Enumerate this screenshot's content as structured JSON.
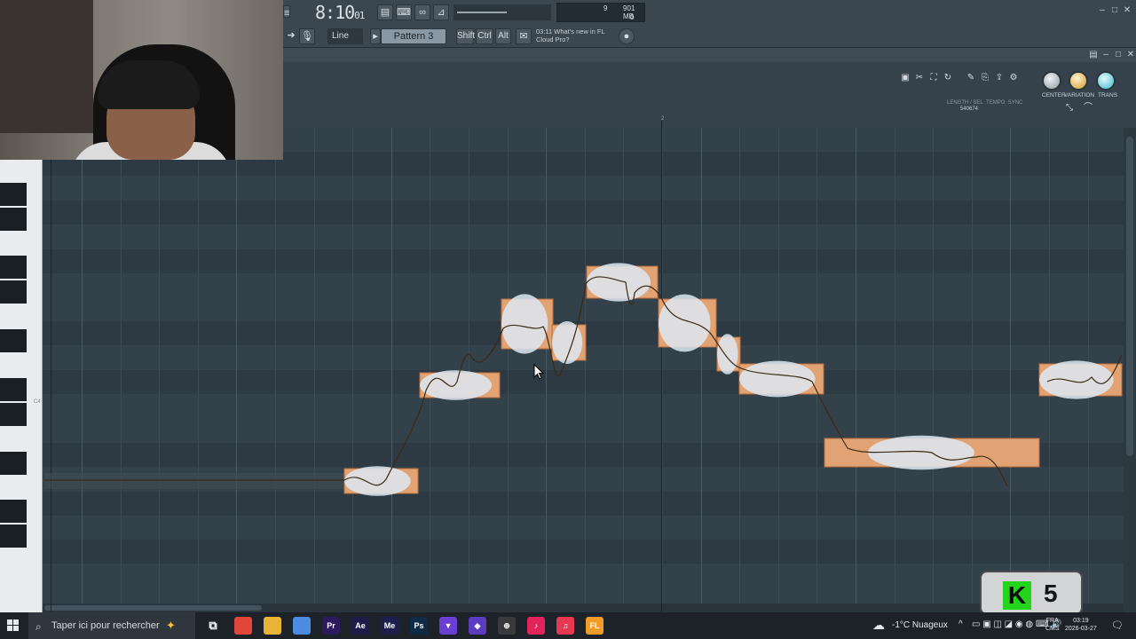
{
  "toolbar": {
    "time_main": "8:10",
    "time_sub": "01",
    "snap_label": "Line",
    "pattern_label": "Pattern 3",
    "shift_label": "Shift",
    "ctrl_label": "Ctrl",
    "alt_label": "Alt",
    "news_line1": "03:11  What's new in FL",
    "news_line2": "Cloud Pro?",
    "cpu_value": "9",
    "memory_value": "901 MB",
    "poly_value": "0"
  },
  "plugin": {
    "knobs": [
      {
        "label": "CENTER"
      },
      {
        "label": "VARIATION"
      },
      {
        "label": "TRANS"
      }
    ],
    "length_label": "LENGTH / SEL",
    "tempo_label": "TEMPO",
    "sync_label": "SYNC",
    "length_value": "540674",
    "bar_marker": "2"
  },
  "key_label": "C4",
  "overlay": {
    "k5_number": "5"
  },
  "taskbar": {
    "search_placeholder": "Taper ici pour rechercher",
    "weather": "-1°C  Nuageux",
    "lang_top": "FRA",
    "lang_bottom": "CMS",
    "time": "03:19",
    "date": "2026-03-27",
    "apps": [
      {
        "name": "chrome-app",
        "color": "#e0463a",
        "label": ""
      },
      {
        "name": "file-explorer-app",
        "color": "#e8b437",
        "label": ""
      },
      {
        "name": "chrome-alt-app",
        "color": "#4b8be0",
        "label": ""
      },
      {
        "name": "premiere-app",
        "color": "#2b1a5c",
        "label": "Pr"
      },
      {
        "name": "after-effects-app",
        "color": "#1f1a4a",
        "label": "Ae"
      },
      {
        "name": "media-encoder-app",
        "color": "#1c1f4e",
        "label": "Me"
      },
      {
        "name": "photoshop-app",
        "color": "#0f2a44",
        "label": "Ps"
      },
      {
        "name": "vpn-app",
        "color": "#6a3ed0",
        "label": "▼"
      },
      {
        "name": "shield-app",
        "color": "#5b3bbf",
        "label": "◈"
      },
      {
        "name": "network-app",
        "color": "#3a3a3a",
        "label": "⊕"
      },
      {
        "name": "tiktok-app",
        "color": "#e3245a",
        "label": "♪"
      },
      {
        "name": "music-app",
        "color": "#e83752",
        "label": "♫"
      },
      {
        "name": "fl-studio-app",
        "color": "#f09b2a",
        "label": "FL"
      }
    ]
  }
}
